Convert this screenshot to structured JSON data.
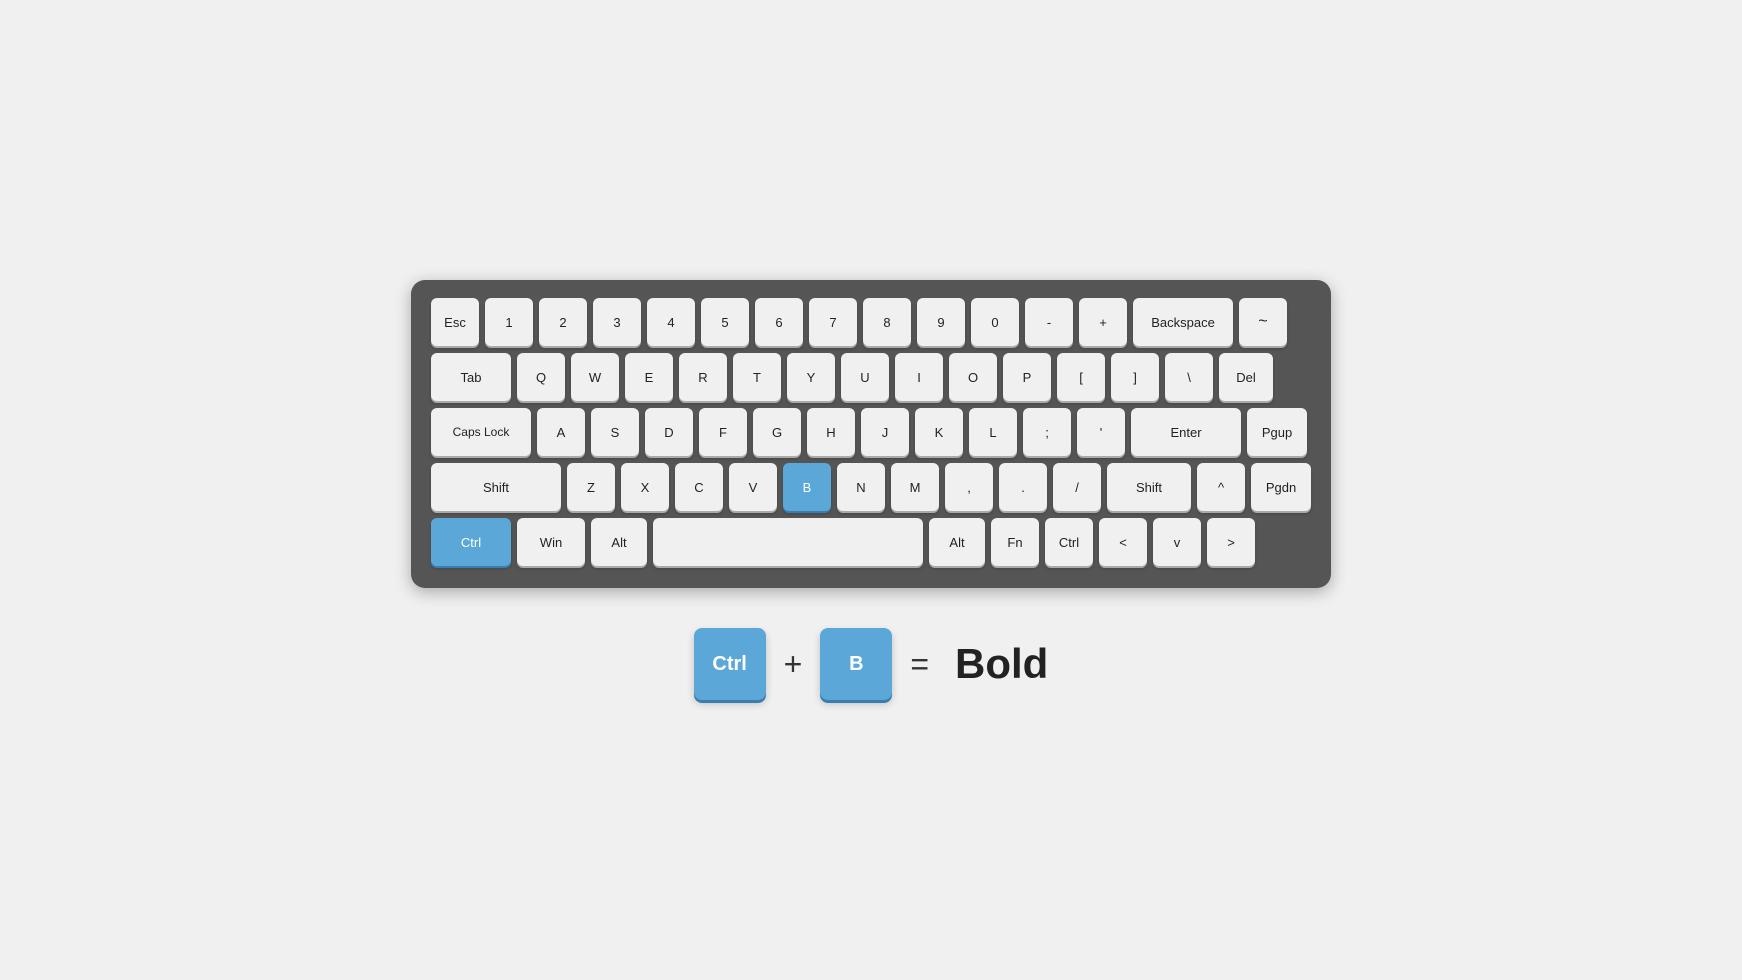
{
  "keyboard": {
    "rows": [
      {
        "id": "row1",
        "keys": [
          {
            "label": "Esc",
            "class": ""
          },
          {
            "label": "1",
            "class": ""
          },
          {
            "label": "2",
            "class": ""
          },
          {
            "label": "3",
            "class": ""
          },
          {
            "label": "4",
            "class": ""
          },
          {
            "label": "5",
            "class": ""
          },
          {
            "label": "6",
            "class": ""
          },
          {
            "label": "7",
            "class": ""
          },
          {
            "label": "8",
            "class": ""
          },
          {
            "label": "9",
            "class": ""
          },
          {
            "label": "0",
            "class": ""
          },
          {
            "label": "-",
            "class": ""
          },
          {
            "label": "+",
            "class": ""
          },
          {
            "label": "Backspace",
            "class": "wide-backspace"
          },
          {
            "label": "~",
            "class": "tilde"
          }
        ]
      },
      {
        "id": "row2",
        "keys": [
          {
            "label": "Tab",
            "class": "wide-tab"
          },
          {
            "label": "Q",
            "class": ""
          },
          {
            "label": "W",
            "class": ""
          },
          {
            "label": "E",
            "class": ""
          },
          {
            "label": "R",
            "class": ""
          },
          {
            "label": "T",
            "class": ""
          },
          {
            "label": "Y",
            "class": ""
          },
          {
            "label": "U",
            "class": ""
          },
          {
            "label": "I",
            "class": ""
          },
          {
            "label": "O",
            "class": ""
          },
          {
            "label": "P",
            "class": ""
          },
          {
            "label": "[",
            "class": ""
          },
          {
            "label": "]",
            "class": ""
          },
          {
            "label": "\\",
            "class": ""
          },
          {
            "label": "Del",
            "class": "wide-del"
          }
        ]
      },
      {
        "id": "row3",
        "keys": [
          {
            "label": "Caps Lock",
            "class": "wide-caps"
          },
          {
            "label": "A",
            "class": ""
          },
          {
            "label": "S",
            "class": ""
          },
          {
            "label": "D",
            "class": ""
          },
          {
            "label": "F",
            "class": ""
          },
          {
            "label": "G",
            "class": ""
          },
          {
            "label": "H",
            "class": ""
          },
          {
            "label": "J",
            "class": ""
          },
          {
            "label": "K",
            "class": ""
          },
          {
            "label": "L",
            "class": ""
          },
          {
            "label": ";",
            "class": ""
          },
          {
            "label": "'",
            "class": ""
          },
          {
            "label": "Enter",
            "class": "wide-enter"
          },
          {
            "label": "Pgup",
            "class": "wide-pgup"
          }
        ]
      },
      {
        "id": "row4",
        "keys": [
          {
            "label": "Shift",
            "class": "wide-shift-l"
          },
          {
            "label": "Z",
            "class": ""
          },
          {
            "label": "X",
            "class": ""
          },
          {
            "label": "C",
            "class": ""
          },
          {
            "label": "V",
            "class": ""
          },
          {
            "label": "B",
            "class": "highlight"
          },
          {
            "label": "N",
            "class": ""
          },
          {
            "label": "M",
            "class": ""
          },
          {
            "label": ",",
            "class": ""
          },
          {
            "label": ".",
            "class": ""
          },
          {
            "label": "/",
            "class": ""
          },
          {
            "label": "Shift",
            "class": "wide-shift-r"
          },
          {
            "label": "^",
            "class": ""
          },
          {
            "label": "Pgdn",
            "class": "wide-pgdn"
          }
        ]
      },
      {
        "id": "row5",
        "keys": [
          {
            "label": "Ctrl",
            "class": "wide-ctrl-l highlight"
          },
          {
            "label": "Win",
            "class": "wide-win"
          },
          {
            "label": "Alt",
            "class": "wide-alt"
          },
          {
            "label": "",
            "class": "wide-space"
          },
          {
            "label": "Alt",
            "class": "wide-alt"
          },
          {
            "label": "Fn",
            "class": ""
          },
          {
            "label": "Ctrl",
            "class": ""
          },
          {
            "label": "<",
            "class": ""
          },
          {
            "label": "v",
            "class": ""
          },
          {
            "label": ">",
            "class": ""
          }
        ]
      }
    ]
  },
  "shortcut": {
    "key1": "Ctrl",
    "plus": "+",
    "key2": "B",
    "equals": "=",
    "label": "Bold"
  }
}
